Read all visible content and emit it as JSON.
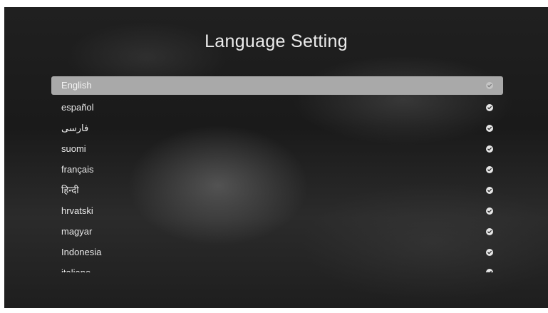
{
  "title": "Language Setting",
  "languages": [
    {
      "label": "English",
      "selected": true
    },
    {
      "label": "español",
      "selected": false
    },
    {
      "label": "فارسی",
      "selected": false
    },
    {
      "label": "suomi",
      "selected": false
    },
    {
      "label": "français",
      "selected": false
    },
    {
      "label": "हिन्दी",
      "selected": false
    },
    {
      "label": "hrvatski",
      "selected": false
    },
    {
      "label": "magyar",
      "selected": false
    },
    {
      "label": "Indonesia",
      "selected": false
    },
    {
      "label": "italiano",
      "selected": false
    }
  ],
  "icons": {
    "check": "check-circle-icon"
  },
  "colors": {
    "highlight": "#a9a9a9",
    "text": "#eaeaea",
    "background": "#1e1e1e"
  }
}
